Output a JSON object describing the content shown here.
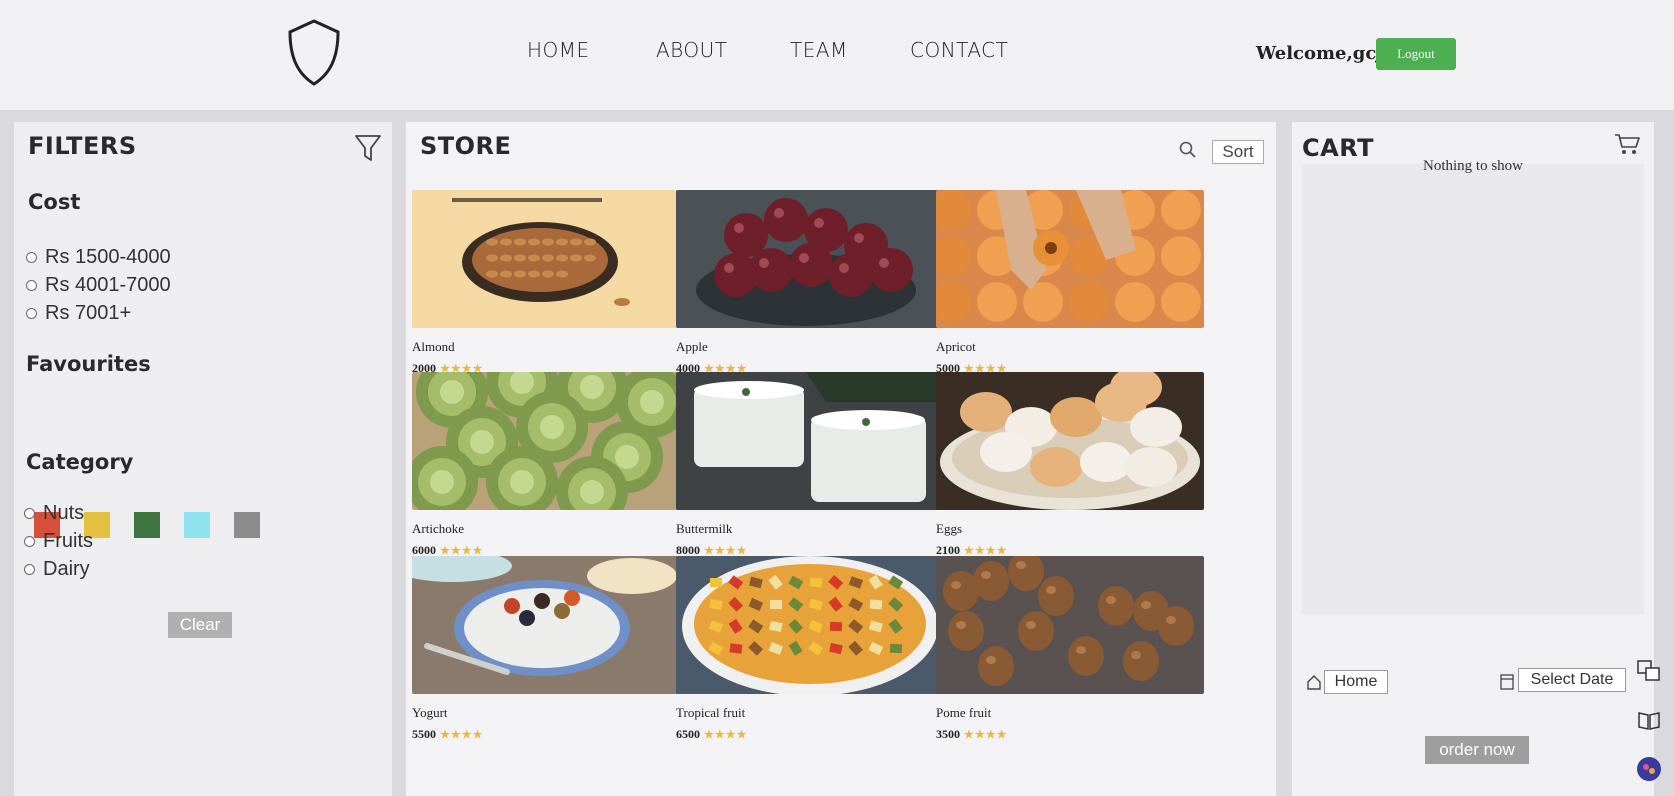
{
  "header": {
    "nav": [
      "HOME",
      "ABOUT",
      "TEAM",
      "CONTACT"
    ],
    "welcome": "Welcome,gcj",
    "logout_label": "Logout"
  },
  "filters": {
    "title": "FILTERS",
    "cost_title": "Cost",
    "cost_options": [
      "Rs 1500-4000",
      "Rs 4001-7000",
      "Rs 7001+"
    ],
    "favourites_title": "Favourites",
    "favourite_colors": [
      "#d9503a",
      "#e2c23e",
      "#3f7440",
      "#8fe3ef",
      "#8c8c8c"
    ],
    "category_title": "Category",
    "category_options": [
      "Nuts",
      "Fruits",
      "Dairy"
    ],
    "clear_label": "Clear"
  },
  "store": {
    "title": "STORE",
    "sort_label": "Sort",
    "products": [
      {
        "name": "Almond",
        "price": "2000",
        "rating": 4
      },
      {
        "name": "Apple",
        "price": "4000",
        "rating": 4
      },
      {
        "name": "Apricot",
        "price": "5000",
        "rating": 4
      },
      {
        "name": "Artichoke",
        "price": "6000",
        "rating": 4
      },
      {
        "name": "Buttermilk",
        "price": "8000",
        "rating": 4
      },
      {
        "name": "Eggs",
        "price": "2100",
        "rating": 4
      },
      {
        "name": "Yogurt",
        "price": "5500",
        "rating": 4
      },
      {
        "name": "Tropical fruit",
        "price": "6500",
        "rating": 4
      },
      {
        "name": "Pome fruit",
        "price": "3500",
        "rating": 4
      }
    ]
  },
  "cart": {
    "title": "CART",
    "empty_text": "Nothing to show",
    "home_label": "Home",
    "select_date_label": "Select Date",
    "order_label": "order now"
  },
  "icons": [
    "shield-logo-icon",
    "filter-icon",
    "search-icon",
    "cart-icon",
    "home-icon",
    "calendar-icon",
    "translate-icon",
    "reader-icon",
    "assistant-icon"
  ]
}
